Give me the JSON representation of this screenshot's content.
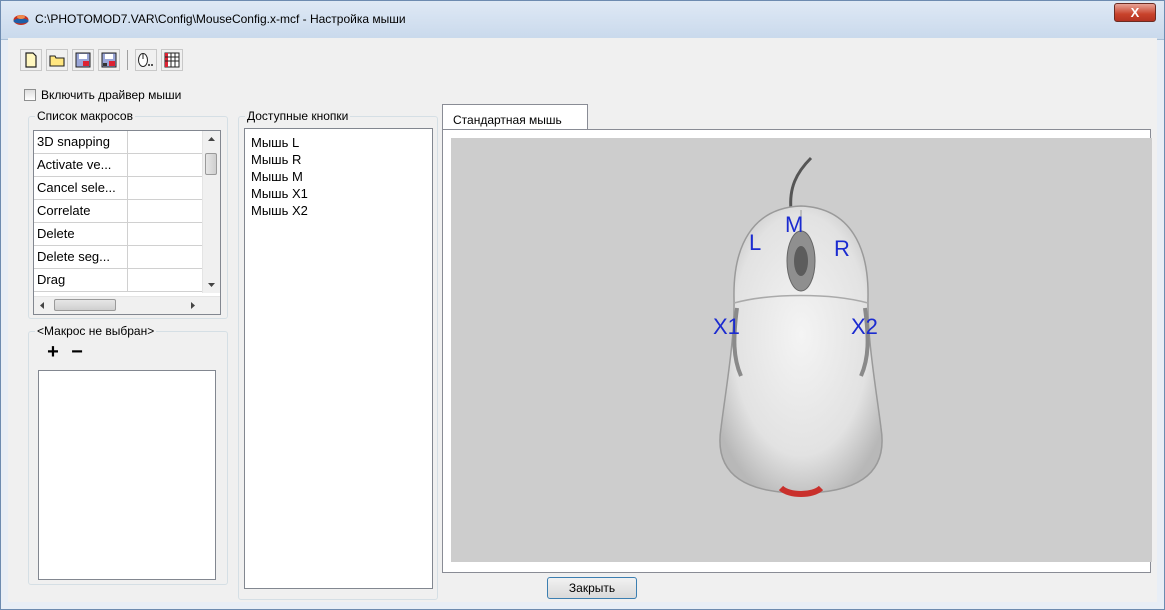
{
  "window": {
    "title": "C:\\PHOTOMOD7.VAR\\Config\\MouseConfig.x-mcf - Настройка мыши",
    "close_glyph": "X"
  },
  "toolbar": {
    "icons": [
      "new-file-icon",
      "open-folder-icon",
      "save-icon",
      "save-as-icon",
      "mouse-settings-icon",
      "table-icon"
    ]
  },
  "driver_checkbox": {
    "label": "Включить драйвер мыши",
    "checked": false
  },
  "macros": {
    "group_label": "Список макросов",
    "items": [
      "3D snapping",
      "Activate ve...",
      "Cancel sele...",
      "Correlate",
      "Delete",
      "Delete seg...",
      "Drag"
    ]
  },
  "macro_editor": {
    "group_label": "<Макрос не выбран>",
    "add_label": "+",
    "remove_label": "−"
  },
  "buttons_list": {
    "group_label": "Доступные кнопки",
    "items": [
      "Мышь L",
      "Мышь R",
      "Мышь M",
      "Мышь X1",
      "Мышь X2"
    ]
  },
  "tabs": {
    "active": "Стандартная мышь"
  },
  "mouse_labels": {
    "left": "L",
    "middle": "M",
    "right": "R",
    "x1": "X1",
    "x2": "X2"
  },
  "footer": {
    "close_label": "Закрыть"
  },
  "colors": {
    "label_blue": "#1b2bd0",
    "panel_gray": "#cdcdcd"
  }
}
